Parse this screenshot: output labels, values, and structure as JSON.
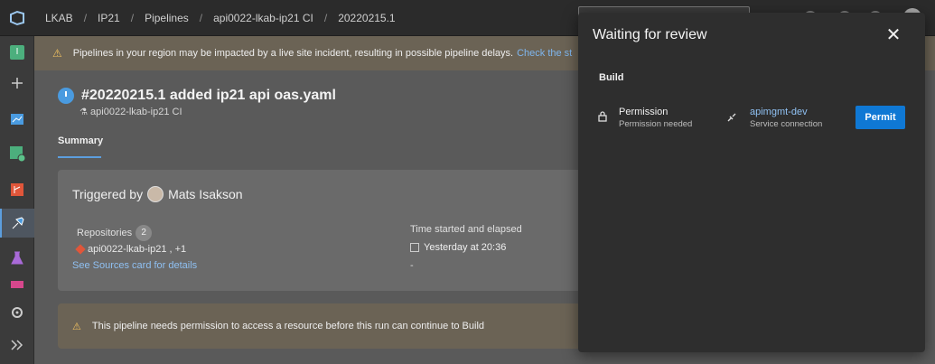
{
  "breadcrumb": [
    "LKAB",
    "IP21",
    "Pipelines",
    "api0022-lkab-ip21 CI",
    "20220215.1"
  ],
  "banner": {
    "text": "Pipelines in your region may be impacted by a live site incident, resulting in possible pipeline delays.",
    "link": "Check the st"
  },
  "run": {
    "title": "#20220215.1 added ip21 api oas.yaml",
    "pipeline": "api0022-lkab-ip21 CI"
  },
  "tabs": {
    "summary": "Summary"
  },
  "card": {
    "triggered_by_label": "Triggered by",
    "user": "Mats Isakson",
    "repositories_label": "Repositories",
    "repositories_count": "2",
    "repository_value": "api0022-lkab-ip21 , +1",
    "sources_link": "See Sources card for details",
    "time_label": "Time started and elapsed",
    "time_value": "Yesterday at 20:36",
    "elapsed": "-"
  },
  "permission_banner": "This pipeline needs permission to access a resource before this run can continue to Build",
  "dialog": {
    "title": "Waiting for review",
    "stage": "Build",
    "check_title": "Permission",
    "check_subtitle": "Permission needed",
    "resource_name": "apimgmt-dev",
    "resource_type": "Service connection",
    "permit_label": "Permit"
  },
  "colors": {
    "accent": "#0f78d4",
    "link": "#8fc0f2",
    "warning_bg": "#6b6355",
    "panel_bg": "#2e2e2e"
  }
}
